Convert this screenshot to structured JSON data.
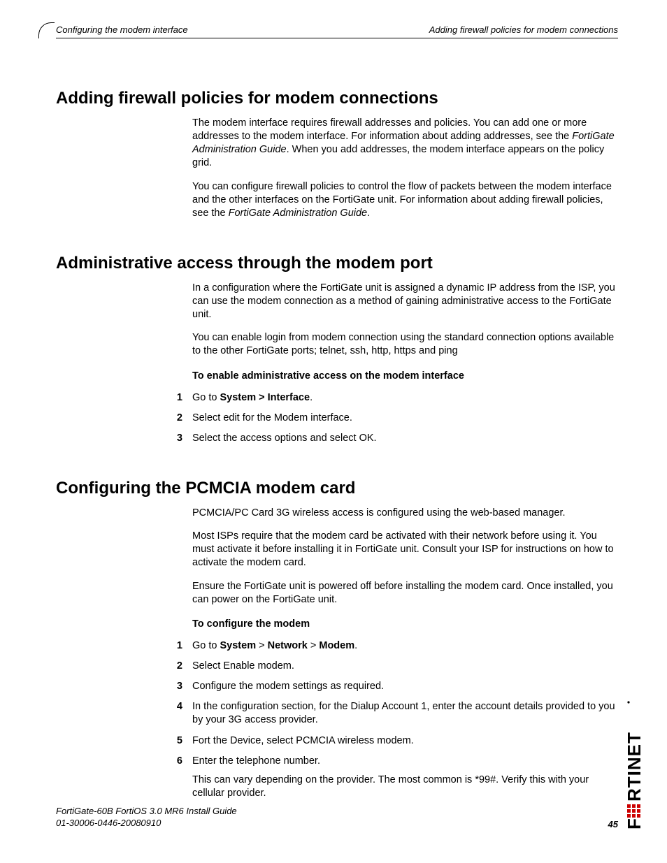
{
  "header": {
    "left": "Configuring the modem interface",
    "right": "Adding firewall policies for modem connections"
  },
  "sections": {
    "s1": {
      "title": "Adding firewall policies for modem connections",
      "p1_a": "The modem interface requires firewall addresses and policies. You can add one or more addresses to the modem interface. For information about adding addresses, see the ",
      "p1_i": "FortiGate Administration Guide",
      "p1_b": ". When you add addresses, the modem interface appears on the policy grid.",
      "p2_a": "You can configure firewall policies to control the flow of packets between the modem interface and the other interfaces on the FortiGate unit. For information about adding firewall policies, see the ",
      "p2_i": "FortiGate Administration Guide",
      "p2_b": "."
    },
    "s2": {
      "title": "Administrative access through the modem port",
      "p1": "In a configuration where the FortiGate unit is assigned a dynamic IP address from the ISP, you can use the modem connection as a method of gaining administrative access to the FortiGate unit.",
      "p2": "You can enable login from modem connection using the standard connection options available to the other FortiGate ports; telnet, ssh, http, https and ping",
      "sub": "To enable administrative access on the modem interface",
      "step1_a": "Go to ",
      "step1_b": "System > Interface",
      "step1_c": ".",
      "step2": "Select edit for the Modem interface.",
      "step3": "Select the access options and select OK."
    },
    "s3": {
      "title": "Configuring the PCMCIA modem card",
      "p1": "PCMCIA/PC Card 3G wireless access is configured using the web-based manager.",
      "p2": "Most ISPs require that the modem card be activated with their network before using it. You must activate it before installing it in FortiGate unit. Consult your ISP for instructions on how to activate the modem card.",
      "p3": "Ensure the FortiGate unit is powered off before installing the modem card. Once installed, you can power on the FortiGate unit.",
      "sub": "To configure the modem",
      "st1_a": "Go to ",
      "st1_b1": "System",
      "st1_g1": " > ",
      "st1_b2": "Network",
      "st1_g2": " > ",
      "st1_b3": "Modem",
      "st1_c": ".",
      "st2": "Select Enable modem.",
      "st3": "Configure the modem settings as required.",
      "st4": "In the configuration section, for the Dialup Account 1, enter the account details provided to you by your 3G access provider.",
      "st5": "Fort the Device, select PCMCIA wireless modem.",
      "st6": "Enter the telephone number.",
      "st6n": "This can vary depending on the provider. The most common is *99#. Verify this with your cellular provider."
    }
  },
  "footer": {
    "line1": "FortiGate-60B FortiOS 3.0 MR6 Install Guide",
    "line2": "01-30006-0446-20080910",
    "page": "45"
  }
}
